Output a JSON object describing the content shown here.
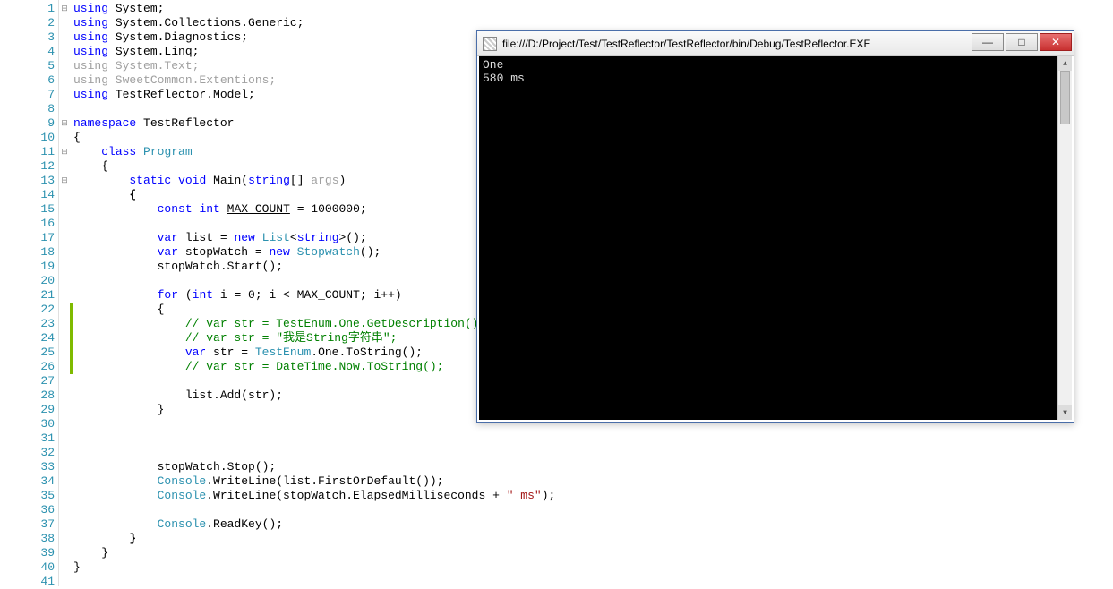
{
  "console": {
    "title": "file:///D:/Project/Test/TestReflector/TestReflector/bin/Debug/TestReflector.EXE",
    "lines": [
      "One",
      "580 ms"
    ],
    "min_label": "—",
    "max_label": "□",
    "close_label": "✕"
  },
  "editor": {
    "total_lines": 41,
    "fold_lines": [
      1,
      9,
      11,
      13
    ],
    "modified_lines": [
      22,
      23,
      24,
      25,
      26
    ],
    "lines": [
      {
        "n": 1,
        "html": "<span class='kw'>using</span> System<span class='pun'>;</span>"
      },
      {
        "n": 2,
        "html": "<span class='kw'>using</span> System.Collections.Generic<span class='pun'>;</span>"
      },
      {
        "n": 3,
        "html": "<span class='kw'>using</span> System.Diagnostics<span class='pun'>;</span>"
      },
      {
        "n": 4,
        "html": "<span class='kw'>using</span> System.Linq<span class='pun'>;</span>"
      },
      {
        "n": 5,
        "html": "<span class='dim'>using System.Text;</span>"
      },
      {
        "n": 6,
        "html": "<span class='dim'>using SweetCommon.Extentions;</span>"
      },
      {
        "n": 7,
        "html": "<span class='kw'>using</span> TestReflector.Model<span class='pun'>;</span>"
      },
      {
        "n": 8,
        "html": ""
      },
      {
        "n": 9,
        "html": "<span class='kw'>namespace</span> TestReflector"
      },
      {
        "n": 10,
        "html": "{"
      },
      {
        "n": 11,
        "html": "    <span class='kw'>class</span> <span class='typ'>Program</span>"
      },
      {
        "n": 12,
        "html": "    {"
      },
      {
        "n": 13,
        "html": "        <span class='kw'>static</span> <span class='kw'>void</span> Main(<span class='kw'>string</span>[] <span class='dim'>args</span>)"
      },
      {
        "n": 14,
        "html": "        <b>{</b>"
      },
      {
        "n": 15,
        "html": "            <span class='kw'>const</span> <span class='kw'>int</span> <u>MAX_COUNT</u> = 1000000;"
      },
      {
        "n": 16,
        "html": ""
      },
      {
        "n": 17,
        "html": "            <span class='kw'>var</span> list = <span class='kw'>new</span> <span class='typ'>List</span>&lt;<span class='kw'>string</span>&gt;();"
      },
      {
        "n": 18,
        "html": "            <span class='kw'>var</span> stopWatch = <span class='kw'>new</span> <span class='typ'>Stopwatch</span>();"
      },
      {
        "n": 19,
        "html": "            stopWatch.Start();"
      },
      {
        "n": 20,
        "html": ""
      },
      {
        "n": 21,
        "html": "            <span class='kw'>for</span> (<span class='kw'>int</span> i = 0; i &lt; MAX_COUNT; i++)"
      },
      {
        "n": 22,
        "html": "            {"
      },
      {
        "n": 23,
        "html": "                <span class='cmt'>// var str = TestEnum.One.GetDescription();</span>"
      },
      {
        "n": 24,
        "html": "                <span class='cmt'>// var str = \"我是String字符串\";</span>"
      },
      {
        "n": 25,
        "html": "                <span class='kw'>var</span> str = <span class='typ'>TestEnum</span>.One.ToString();"
      },
      {
        "n": 26,
        "html": "                <span class='cmt'>// var str = DateTime.Now.ToString();</span>"
      },
      {
        "n": 27,
        "html": ""
      },
      {
        "n": 28,
        "html": "                list.Add(str);"
      },
      {
        "n": 29,
        "html": "            }"
      },
      {
        "n": 30,
        "html": ""
      },
      {
        "n": 31,
        "html": ""
      },
      {
        "n": 32,
        "html": ""
      },
      {
        "n": 33,
        "html": "            stopWatch.Stop();"
      },
      {
        "n": 34,
        "html": "            <span class='typ'>Console</span>.WriteLine(list.FirstOrDefault());"
      },
      {
        "n": 35,
        "html": "            <span class='typ'>Console</span>.WriteLine(stopWatch.ElapsedMilliseconds + <span class='str'>\" ms\"</span>);"
      },
      {
        "n": 36,
        "html": ""
      },
      {
        "n": 37,
        "html": "            <span class='typ'>Console</span>.ReadKey();"
      },
      {
        "n": 38,
        "html": "        <b>}</b>"
      },
      {
        "n": 39,
        "html": "    }"
      },
      {
        "n": 40,
        "html": "}"
      },
      {
        "n": 41,
        "html": ""
      }
    ]
  }
}
